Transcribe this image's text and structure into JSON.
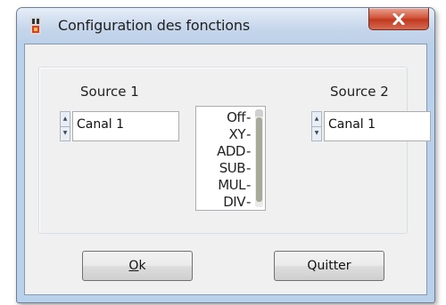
{
  "window": {
    "title": "Configuration des fonctions",
    "close_glyph": "X",
    "icon": "app-icon"
  },
  "source1": {
    "label": "Source 1",
    "value": "Canal 1"
  },
  "source2": {
    "label": "Source 2",
    "value": "Canal 1"
  },
  "functions": {
    "items": [
      "Off",
      "XY",
      "ADD",
      "SUB",
      "MUL",
      "DIV"
    ]
  },
  "buttons": {
    "ok_mnemonic": "O",
    "ok_rest": "k",
    "quit_label": "Quitter"
  },
  "colors": {
    "close_button": "#c9452a",
    "frame": "#b9d1ea",
    "client": "#f0f0f0"
  }
}
